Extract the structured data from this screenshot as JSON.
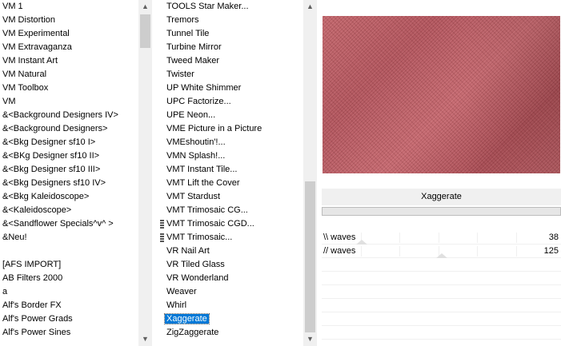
{
  "categories": {
    "items": [
      "VM 1",
      "VM Distortion",
      "VM Experimental",
      "VM Extravaganza",
      "VM Instant Art",
      "VM Natural",
      "VM Toolbox",
      "VM",
      "&<Background Designers IV>",
      "&<Background Designers>",
      "&<Bkg Designer sf10 I>",
      "&<BKg Designer sf10 II>",
      "&<Bkg Designer sf10 III>",
      "&<Bkg Designers sf10 IV>",
      "&<Bkg Kaleidoscope>",
      "&<Kaleidoscope>",
      "&<Sandflower Specials^v^ >",
      "&Neu!",
      "",
      "[AFS IMPORT]",
      "AB Filters 2000",
      "a",
      "Alf's Border FX",
      "Alf's Power Grads",
      "Alf's Power Sines"
    ]
  },
  "filters": {
    "items": [
      {
        "label": "TOOLS Star Maker...",
        "marker": false,
        "selected": false
      },
      {
        "label": "Tremors",
        "marker": false,
        "selected": false
      },
      {
        "label": "Tunnel Tile",
        "marker": false,
        "selected": false
      },
      {
        "label": "Turbine Mirror",
        "marker": false,
        "selected": false
      },
      {
        "label": "Tweed Maker",
        "marker": false,
        "selected": false
      },
      {
        "label": "Twister",
        "marker": false,
        "selected": false
      },
      {
        "label": "UP White Shimmer",
        "marker": false,
        "selected": false
      },
      {
        "label": "UPC Factorize...",
        "marker": false,
        "selected": false
      },
      {
        "label": "UPE Neon...",
        "marker": false,
        "selected": false
      },
      {
        "label": "VME Picture in a Picture",
        "marker": false,
        "selected": false
      },
      {
        "label": "VMEshoutin'!...",
        "marker": false,
        "selected": false
      },
      {
        "label": "VMN Splash!...",
        "marker": false,
        "selected": false
      },
      {
        "label": "VMT Instant Tile...",
        "marker": false,
        "selected": false
      },
      {
        "label": "VMT Lift the Cover",
        "marker": false,
        "selected": false
      },
      {
        "label": "VMT Stardust",
        "marker": false,
        "selected": false
      },
      {
        "label": "VMT Trimosaic CG...",
        "marker": false,
        "selected": false
      },
      {
        "label": "VMT Trimosaic CGD...",
        "marker": true,
        "selected": false
      },
      {
        "label": "VMT Trimosaic...",
        "marker": true,
        "selected": false
      },
      {
        "label": "VR Nail Art",
        "marker": false,
        "selected": false
      },
      {
        "label": "VR Tiled Glass",
        "marker": false,
        "selected": false
      },
      {
        "label": "VR Wonderland",
        "marker": false,
        "selected": false
      },
      {
        "label": "Weaver",
        "marker": false,
        "selected": false
      },
      {
        "label": "Whirl",
        "marker": false,
        "selected": false
      },
      {
        "label": "Xaggerate",
        "marker": false,
        "selected": true
      },
      {
        "label": "ZigZaggerate",
        "marker": false,
        "selected": false
      }
    ]
  },
  "filter_panel": {
    "name": "Xaggerate",
    "progress": 0,
    "params": [
      {
        "name": "\\\\ waves",
        "value": "38",
        "level": 0.149
      },
      {
        "name": "// waves",
        "value": "125",
        "level": 0.49
      }
    ],
    "empty_rows": 6
  },
  "colors": {
    "selection": "#0078d7",
    "preview_base": "#c86a70"
  }
}
